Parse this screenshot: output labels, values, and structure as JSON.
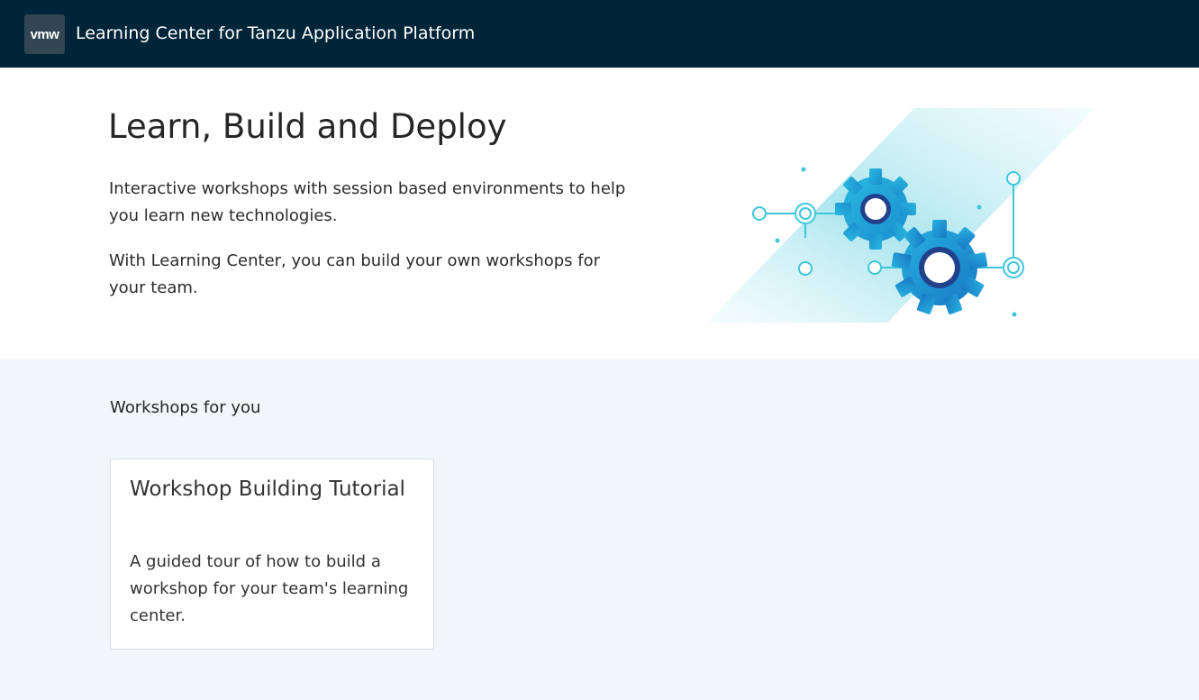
{
  "header": {
    "logo_text": "vmw",
    "title": "Learning Center for Tanzu Application Platform"
  },
  "hero": {
    "title": "Learn, Build and Deploy",
    "paragraph1": "Interactive workshops with session based environments to help you learn new technologies.",
    "paragraph2": "With Learning Center, you can build your own workshops for your team.",
    "illustration": "gears-icon"
  },
  "workshops": {
    "section_title": "Workshops for you",
    "cards": [
      {
        "title": "Workshop Building Tutorial",
        "description": "A guided tour of how to build a workshop for your team's learning center."
      }
    ]
  },
  "colors": {
    "header_bg": "#002538",
    "logo_bg": "#314652",
    "page_bg": "#f3f6f9",
    "gear_primary": "#1d9fd6",
    "accent_cyan": "#3ec6da"
  }
}
